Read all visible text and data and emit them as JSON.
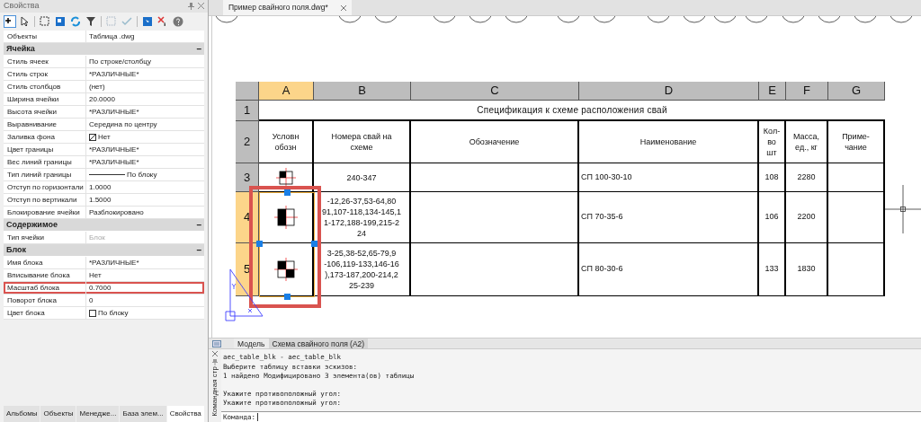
{
  "properties_panel": {
    "title": "Свойства",
    "rows": [
      {
        "kind": "property",
        "label": "Объекты",
        "value": "Таблица .dwg",
        "disabled": false,
        "highlighted": false
      },
      {
        "kind": "section",
        "label": "Ячейка",
        "toggle": "–"
      },
      {
        "kind": "property",
        "label": "Стиль ячеек",
        "value": "По строке/столбцу",
        "disabled": false,
        "highlighted": false
      },
      {
        "kind": "property",
        "label": "Стиль строк",
        "value": "*РАЗЛИЧНЫЕ*",
        "disabled": false,
        "highlighted": false
      },
      {
        "kind": "property",
        "label": "Стиль столбцов",
        "value": "(нет)",
        "disabled": false,
        "highlighted": false
      },
      {
        "kind": "property",
        "label": "Ширина ячейки",
        "value": "20.0000",
        "disabled": false,
        "highlighted": false
      },
      {
        "kind": "property",
        "label": "Высота ячейки",
        "value": "*РАЗЛИЧНЫЕ*",
        "disabled": false,
        "highlighted": false
      },
      {
        "kind": "property",
        "label": "Выравнивание",
        "value": "Середина по центру",
        "disabled": false,
        "highlighted": false
      },
      {
        "kind": "fill",
        "label": "Заливка фона",
        "value": "Нет",
        "disabled": false,
        "highlighted": false
      },
      {
        "kind": "property",
        "label": "Цвет границы",
        "value": "*РАЗЛИЧНЫЕ*",
        "disabled": false,
        "highlighted": false
      },
      {
        "kind": "property",
        "label": "Вес линий границы",
        "value": "*РАЗЛИЧНЫЕ*",
        "disabled": false,
        "highlighted": false
      },
      {
        "kind": "linetype",
        "label": "Тип линий границы",
        "value": "По блоку",
        "disabled": false,
        "highlighted": false
      },
      {
        "kind": "property",
        "label": "Отступ по горизонтали",
        "value": "1.0000",
        "disabled": false,
        "highlighted": false
      },
      {
        "kind": "property",
        "label": "Отступ по вертикали",
        "value": "1.5000",
        "disabled": false,
        "highlighted": false
      },
      {
        "kind": "property",
        "label": "Блокирование ячейки",
        "value": "Разблокировано",
        "disabled": false,
        "highlighted": false
      },
      {
        "kind": "section",
        "label": "Содержимое",
        "toggle": "–"
      },
      {
        "kind": "property",
        "label": "Тип ячейки",
        "value": "Блок",
        "disabled": true,
        "highlighted": false
      },
      {
        "kind": "section",
        "label": "Блок",
        "toggle": "–"
      },
      {
        "kind": "property",
        "label": "Имя блока",
        "value": "*РАЗЛИЧНЫЕ*",
        "disabled": false,
        "highlighted": false
      },
      {
        "kind": "property",
        "label": "Вписывание блока",
        "value": "Нет",
        "disabled": false,
        "highlighted": false
      },
      {
        "kind": "property",
        "label": "Масштаб блока",
        "value": "0.7000",
        "disabled": false,
        "highlighted": true
      },
      {
        "kind": "property",
        "label": "Поворот блока",
        "value": "0",
        "disabled": false,
        "highlighted": false
      },
      {
        "kind": "color",
        "label": "Цвет блока",
        "value": "По блоку",
        "disabled": false,
        "highlighted": false
      }
    ],
    "tabs": [
      {
        "label": "Альбомы",
        "selected": false
      },
      {
        "label": "Объекты",
        "selected": false
      },
      {
        "label": "Менедже...",
        "selected": false
      },
      {
        "label": "База элем...",
        "selected": false
      },
      {
        "label": "Свойства",
        "selected": true
      }
    ]
  },
  "document_tab": {
    "title": "Пример свайного поля.dwg*"
  },
  "table": {
    "columns": [
      {
        "label": "A",
        "selected": true
      },
      {
        "label": "B",
        "selected": false
      },
      {
        "label": "C",
        "selected": false
      },
      {
        "label": "D",
        "selected": false
      },
      {
        "label": "E",
        "selected": false
      },
      {
        "label": "F",
        "selected": false
      },
      {
        "label": "G",
        "selected": false
      }
    ],
    "title_row": {
      "number": "1",
      "selected": false,
      "text": "Спецификация к схеме расположения свай"
    },
    "header_row": {
      "number": "2",
      "selected": false,
      "cells": [
        [
          "Условн",
          "обозн"
        ],
        [
          "Номера свай на",
          "схеме"
        ],
        [
          "Обозначение"
        ],
        [
          "Наименование"
        ],
        [
          "Кол-",
          "во",
          "шт"
        ],
        [
          "Масса,",
          "ед., кг"
        ],
        [
          "Приме-",
          "чание"
        ]
      ]
    },
    "rows": [
      {
        "number": "3",
        "selected": false,
        "kind": "corner",
        "piles": [
          "240-347"
        ],
        "name": "СП 100-30-10",
        "count": "108",
        "mass": "2280"
      },
      {
        "number": "4",
        "selected": true,
        "kind": "half",
        "piles": [
          "-12,26-37,53-64,80",
          "91,107-118,134-145,1",
          "1-172,188-199,215-2",
          "24"
        ],
        "name": "СП 70-35-6",
        "count": "106",
        "mass": "2200"
      },
      {
        "number": "5",
        "selected": true,
        "kind": "checker",
        "piles": [
          "3-25,38-52,65-79,9",
          "-106,119-133,146-16",
          "),173-187,200-214,2",
          "25-239"
        ],
        "name": "СП 80-30-6",
        "count": "133",
        "mass": "1830"
      }
    ]
  },
  "layout_tabs": [
    {
      "label": "Модель",
      "selected": false
    },
    {
      "label": "Схема свайного поля (A2)",
      "selected": true
    }
  ],
  "command_window": {
    "title": "Командная стр",
    "history": [
      [
        "aec_table_blk - aec_table_blk",
        "Выберите таблицу вставки эскизов:",
        "1 найдено Модифицировано 3 элемента(ов) таблицы"
      ],
      [
        "Укажите противоположный угол:",
        "Укажите противоположный угол:"
      ]
    ],
    "prompt": "Команда:"
  }
}
